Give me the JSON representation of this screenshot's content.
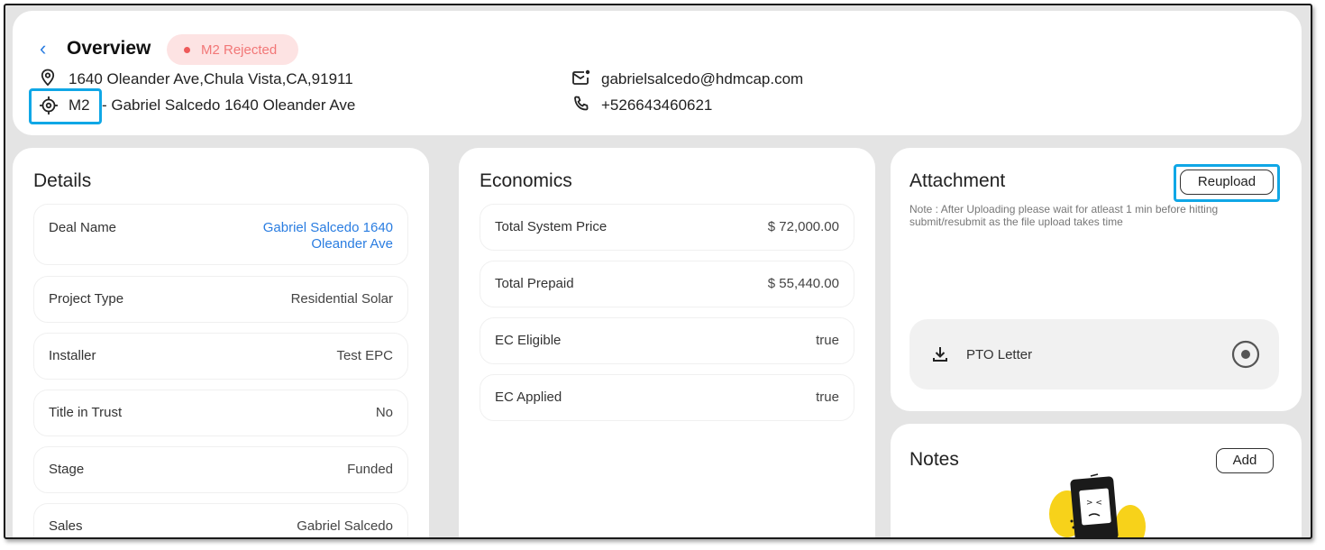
{
  "header": {
    "title": "Overview",
    "status_badge": "M2 Rejected",
    "address": "1640 Oleander Ave,Chula Vista,CA,91911",
    "milestone_code": "M2",
    "milestone_desc": "- Gabriel Salcedo 1640 Oleander Ave",
    "email": "gabrielsalcedo@hdmcap.com",
    "phone": "+526643460621"
  },
  "details": {
    "title": "Details",
    "rows": [
      {
        "label": "Deal Name",
        "value": "Gabriel Salcedo 1640 Oleander Ave"
      },
      {
        "label": "Project Type",
        "value": "Residential Solar"
      },
      {
        "label": "Installer",
        "value": "Test EPC"
      },
      {
        "label": "Title in Trust",
        "value": "No"
      },
      {
        "label": "Stage",
        "value": "Funded"
      },
      {
        "label": "Sales",
        "value": "Gabriel Salcedo"
      }
    ]
  },
  "economics": {
    "title": "Economics",
    "rows": [
      {
        "label": "Total System Price",
        "value": "$ 72,000.00"
      },
      {
        "label": "Total Prepaid",
        "value": "$ 55,440.00"
      },
      {
        "label": "EC Eligible",
        "value": "true"
      },
      {
        "label": "EC Applied",
        "value": "true"
      }
    ]
  },
  "attachment": {
    "title": "Attachment",
    "reupload_label": "Reupload",
    "note": "Note : After Uploading please wait for atleast 1 min before hitting submit/resubmit as the file upload takes time",
    "file_name": "PTO Letter"
  },
  "notes": {
    "title": "Notes",
    "add_label": "Add"
  },
  "colors": {
    "accent": "#2a7de1",
    "highlight": "#10a7e6",
    "badge_bg": "#fde3e3",
    "badge_text": "#f27777"
  },
  "icons": [
    "back-chevron-icon",
    "location-pin-icon",
    "target-icon",
    "mail-icon",
    "phone-icon",
    "download-icon",
    "radio-icon",
    "empty-notes-illustration"
  ]
}
